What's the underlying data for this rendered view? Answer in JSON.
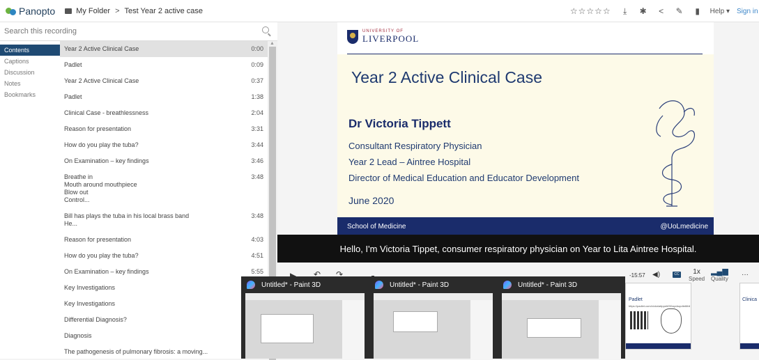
{
  "header": {
    "logo": "Panopto",
    "breadcrumb": [
      "My Folder",
      "Test Year 2 active case"
    ],
    "rating_stars": "☆☆☆☆☆",
    "help": "Help ▾",
    "sign_in": "Sign in"
  },
  "search": {
    "placeholder": "Search this recording"
  },
  "nav": [
    "Contents",
    "Captions",
    "Discussion",
    "Notes",
    "Bookmarks"
  ],
  "toc": [
    {
      "title": "Year 2 Active Clinical Case",
      "time": "0:00"
    },
    {
      "title": "Padlet",
      "time": "0:09"
    },
    {
      "title": "Year 2 Active Clinical Case",
      "time": "0:37"
    },
    {
      "title": "Padlet",
      "time": "1:38"
    },
    {
      "title": "Clinical Case - breathlessness",
      "time": "2:04"
    },
    {
      "title": "Reason for presentation",
      "time": "3:31"
    },
    {
      "title": "How do you play the tuba?",
      "time": "3:44"
    },
    {
      "title": "On Examination – key findings",
      "time": "3:46"
    },
    {
      "title": "Breathe in\nMouth around mouthpiece\nBlow out\nControl...",
      "time": "3:48"
    },
    {
      "title": "Bill has plays the tuba in his local brass band\nHe...",
      "time": "3:48"
    },
    {
      "title": "Reason for presentation",
      "time": "4:03"
    },
    {
      "title": "How do you play the tuba?",
      "time": "4:51"
    },
    {
      "title": "On Examination – key findings",
      "time": "5:55"
    },
    {
      "title": "Key Investigations",
      "time": ""
    },
    {
      "title": "Key Investigations",
      "time": ""
    },
    {
      "title": "Differential Diagnosis?",
      "time": ""
    },
    {
      "title": "Diagnosis",
      "time": ""
    },
    {
      "title": "The pathogenesis of pulmonary fibrosis: a moving...",
      "time": ""
    },
    {
      "title": "Pathophysiology",
      "time": ""
    }
  ],
  "slide": {
    "university_small": "UNIVERSITY OF",
    "university_big": "LIVERPOOL",
    "title": "Year 2 Active Clinical Case",
    "presenter": "Dr Victoria Tippett",
    "roles": [
      "Consultant Respiratory Physician",
      "Year 2 Lead – Aintree Hospital",
      "Director of Medical Education and Educator Development"
    ],
    "date": "June 2020",
    "footer_left": "School of Medicine",
    "footer_right": "@UoLmedicine"
  },
  "caption": "Hello, I'm Victoria Tippet, consumer respiratory physician on Year to Lita Aintree Hospital.",
  "controls": {
    "remaining": "-15:57",
    "speed_value": "1x",
    "speed_label": "Speed",
    "quality_label": "Quality",
    "more": "···",
    "cc": "CC"
  },
  "taskbar": {
    "items": [
      "Untitled* - Paint 3D",
      "Untitled* - Paint 3D",
      "Untitled* - Paint 3D"
    ]
  },
  "thumbnails": [
    {
      "title": "Padlet",
      "url": "https://padlet.com/victoriatippett/5Daycbupdte6thlly"
    },
    {
      "title": "Clinica"
    }
  ],
  "colors": {
    "navy": "#1a2c6b",
    "slide_bg": "#fdfae8",
    "nav_active": "#1f4a73",
    "link": "#3d87c9"
  }
}
